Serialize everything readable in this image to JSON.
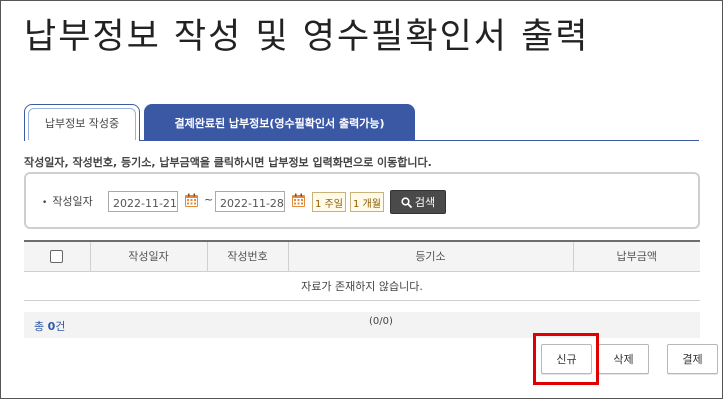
{
  "page_title": "납부정보 작성 및 영수필확인서 출력",
  "tabs": [
    {
      "label": "납부정보 작성중",
      "active": true
    },
    {
      "label": "결제완료된 납부정보(영수필확인서 출력가능)",
      "active": false
    }
  ],
  "instruction": "작성일자, 작성번호, 등기소, 납부금액을 클릭하시면 납부정보 입력화면으로 이동합니다.",
  "search": {
    "bullet": "•",
    "label": "작성일자",
    "date_from": "2022-11-21",
    "separator": "~",
    "date_to": "2022-11-28",
    "week_button": "1 주일",
    "month_button": "1 개월",
    "search_button": "검색"
  },
  "table": {
    "columns": [
      "작성일자",
      "작성번호",
      "등기소",
      "납부금액"
    ],
    "empty_message": "자료가 존재하지 않습니다."
  },
  "footer": {
    "total_prefix": "총",
    "total_count": "0",
    "total_suffix": "건",
    "pager": "(0/0)"
  },
  "buttons": {
    "new": "신규",
    "delete": "삭제",
    "pay": "결제"
  },
  "colors": {
    "tab_active_border": "#3c5aa5",
    "tab_inactive_bg": "#3a58a4",
    "highlight": "#e00000",
    "total_text": "#2f5aa8"
  }
}
